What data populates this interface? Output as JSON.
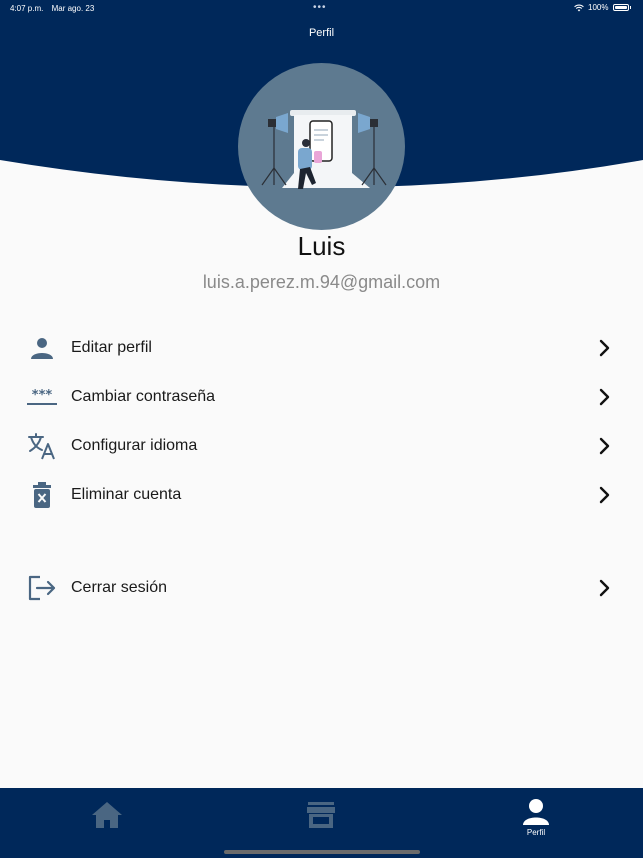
{
  "status_bar": {
    "time": "4:07 p.m.",
    "date": "Mar ago. 23",
    "dots": "•••",
    "battery": "100%",
    "wifi_icon": "wifi-icon",
    "battery_icon": "battery-icon"
  },
  "header": {
    "title": "Perfil",
    "background_color": "#00285a"
  },
  "profile": {
    "name": "Luis",
    "email": "luis.a.perez.m.94@gmail.com",
    "avatar_icon": "photo-studio-illustration"
  },
  "menu": {
    "items": [
      {
        "label": "Editar perfil",
        "icon": "person-icon"
      },
      {
        "label": "Cambiar contraseña",
        "icon": "password-icon"
      },
      {
        "label": "Configurar idioma",
        "icon": "translate-icon"
      },
      {
        "label": "Eliminar cuenta",
        "icon": "delete-icon"
      },
      {
        "label": "Cerrar sesión",
        "icon": "logout-icon"
      }
    ],
    "chevron_icon": "chevron-right-icon",
    "icon_color": "#4a6682"
  },
  "bottom_nav": {
    "items": [
      {
        "label": "",
        "icon": "home-icon",
        "active": false
      },
      {
        "label": "",
        "icon": "store-icon",
        "active": false
      },
      {
        "label": "Perfil",
        "icon": "person-icon",
        "active": true
      }
    ],
    "background_color": "#00285a",
    "inactive_color": "#4a6682",
    "active_color": "#ffffff"
  }
}
